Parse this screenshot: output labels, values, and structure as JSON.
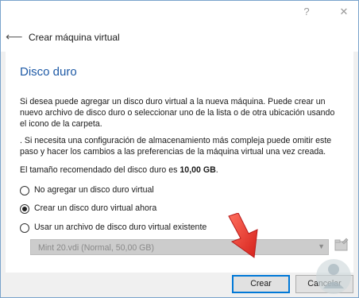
{
  "window": {
    "header_title": "Crear máquina virtual"
  },
  "icons": {
    "help": "?",
    "close": "✕",
    "back": "⟵"
  },
  "page": {
    "title": "Disco duro",
    "paragraph1": "Si desea puede agregar un disco duro virtual a la nueva máquina. Puede crear un nuevo archivo de disco duro o seleccionar uno de la lista o de otra ubicación usando el icono de la carpeta.",
    "paragraph2": ". Si necesita una configuración de almacenamiento más compleja puede omitir este paso y hacer los cambios a las preferencias de la máquina virtual una vez creada.",
    "recommended_prefix": "El tamaño recomendado del disco duro es ",
    "recommended_size": "10,00 GB",
    "recommended_suffix": ".",
    "options": [
      {
        "label": "No agregar un disco duro virtual",
        "selected": false
      },
      {
        "label": "Crear un disco duro virtual ahora",
        "selected": true
      },
      {
        "label": "Usar un archivo de disco duro virtual existente",
        "selected": false
      }
    ],
    "existing_disk_value": "Mint 20.vdi (Normal, 50,00 GB)"
  },
  "footer": {
    "create_label": "Crear",
    "cancel_label": "Cancelar"
  },
  "colors": {
    "title_blue": "#1e5aa6",
    "arrow_red": "#e53935",
    "default_button_border": "#0078d7"
  }
}
